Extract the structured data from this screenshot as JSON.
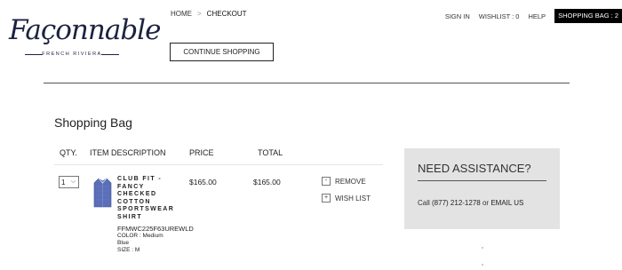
{
  "brand": {
    "name": "Façonnable",
    "tagline": "FRENCH RIVIERA"
  },
  "breadcrumb": {
    "home": "HOME",
    "separator": ">",
    "current": "CHECKOUT"
  },
  "header": {
    "continue_label": "CONTINUE SHOPPING"
  },
  "topnav": {
    "sign_in": "SIGN IN",
    "wishlist": "WISHLIST : 0",
    "help": "HELP",
    "bag": "SHOPPING BAG : 2"
  },
  "cart": {
    "title": "Shopping Bag",
    "columns": {
      "qty": "QTY.",
      "item": "ITEM DESCRIPTION",
      "price": "PRICE",
      "total": "TOTAL"
    },
    "items": [
      {
        "qty": "1",
        "name_lines": [
          "CLUB FIT -",
          "FANCY",
          "CHECKED",
          "COTTON",
          "SPORTSWEAR",
          "SHIRT"
        ],
        "sku": "FFMWC225F63UREWLD",
        "color": "COLOR : Medium Blue",
        "color_line1": "COLOR : Medium",
        "color_line2": "Blue",
        "size": "SIZE : M",
        "price": "$165.00",
        "total": "$165.00",
        "remove_label": "REMOVE",
        "remove_symbol": "-",
        "wishlist_label": "WISH LIST",
        "wishlist_symbol": "+"
      }
    ]
  },
  "help_panel": {
    "title": "NEED ASSISTANCE?",
    "call_prefix": "Call",
    "phone": "(877) 212-1278",
    "or": "or",
    "email": "EMAIL US"
  },
  "icons": {
    "qty_dropdown": "chevron-down-icon",
    "product": "shirt-thumbnail"
  },
  "colors": {
    "accent": "#000000",
    "panel_bg": "#e3e3e3",
    "shirt": "#5b6fb8"
  }
}
